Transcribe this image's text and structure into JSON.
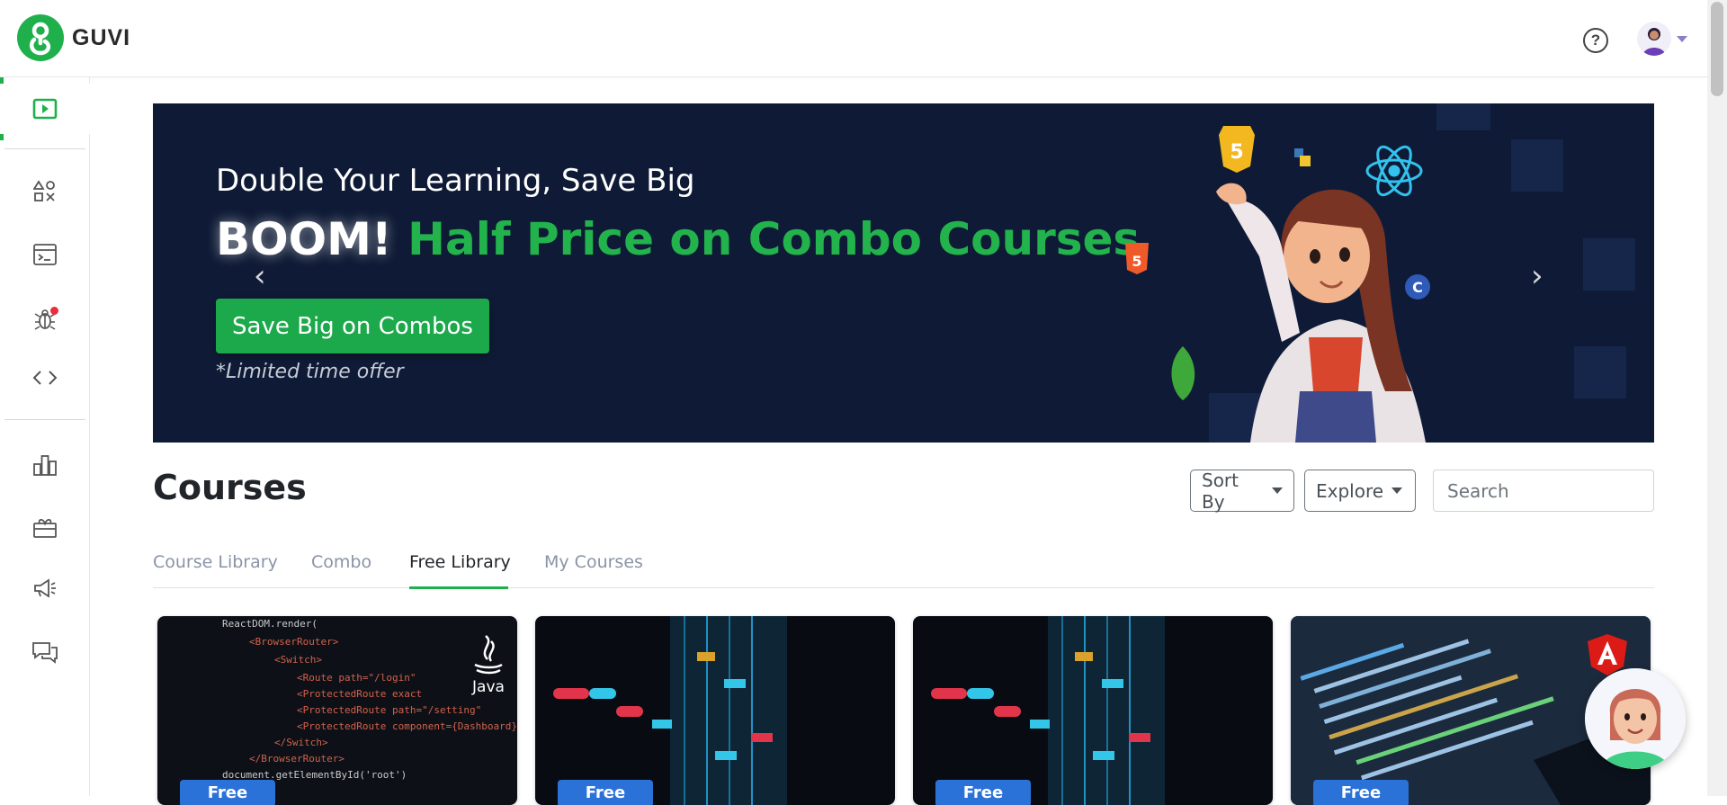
{
  "header": {
    "logo_text": "GUVI",
    "help_icon": "question-circle-icon",
    "avatar_icon": "user-avatar-icon"
  },
  "sidebar": {
    "items": [
      {
        "icon": "play-video-icon",
        "active": true
      },
      {
        "icon": "shapes-practice-icon"
      },
      {
        "icon": "terminal-console-icon"
      },
      {
        "icon": "bug-icon",
        "notification": true
      },
      {
        "icon": "code-brackets-icon"
      },
      {
        "icon": "leaderboard-icon"
      },
      {
        "icon": "gift-rewards-icon"
      },
      {
        "icon": "megaphone-icon"
      },
      {
        "icon": "chat-forum-icon"
      }
    ]
  },
  "banner": {
    "subtitle": "Double Your Learning, Save Big",
    "headline_boom": "BOOM!",
    "headline_rest": "Half Price on Combo Courses",
    "cta": "Save Big on Combos",
    "note": "*Limited time offer",
    "prev_icon": "chevron-left-icon",
    "next_icon": "chevron-right-icon"
  },
  "courses": {
    "title": "Courses",
    "sort_label": "Sort By",
    "explore_label": "Explore",
    "search_placeholder": "Search",
    "tabs": [
      "Course Library",
      "Combo",
      "Free Library",
      "My Courses"
    ],
    "active_tab": "Free Library"
  },
  "cards": [
    {
      "badge": "Free",
      "logo": "Java"
    },
    {
      "badge": "Free"
    },
    {
      "badge": "Free"
    },
    {
      "badge": "Free",
      "logo": "angular-logo"
    }
  ],
  "colors": {
    "brand_green": "#1fb04c",
    "banner_bg": "#0f1b36",
    "badge_blue": "#2b72d8"
  }
}
